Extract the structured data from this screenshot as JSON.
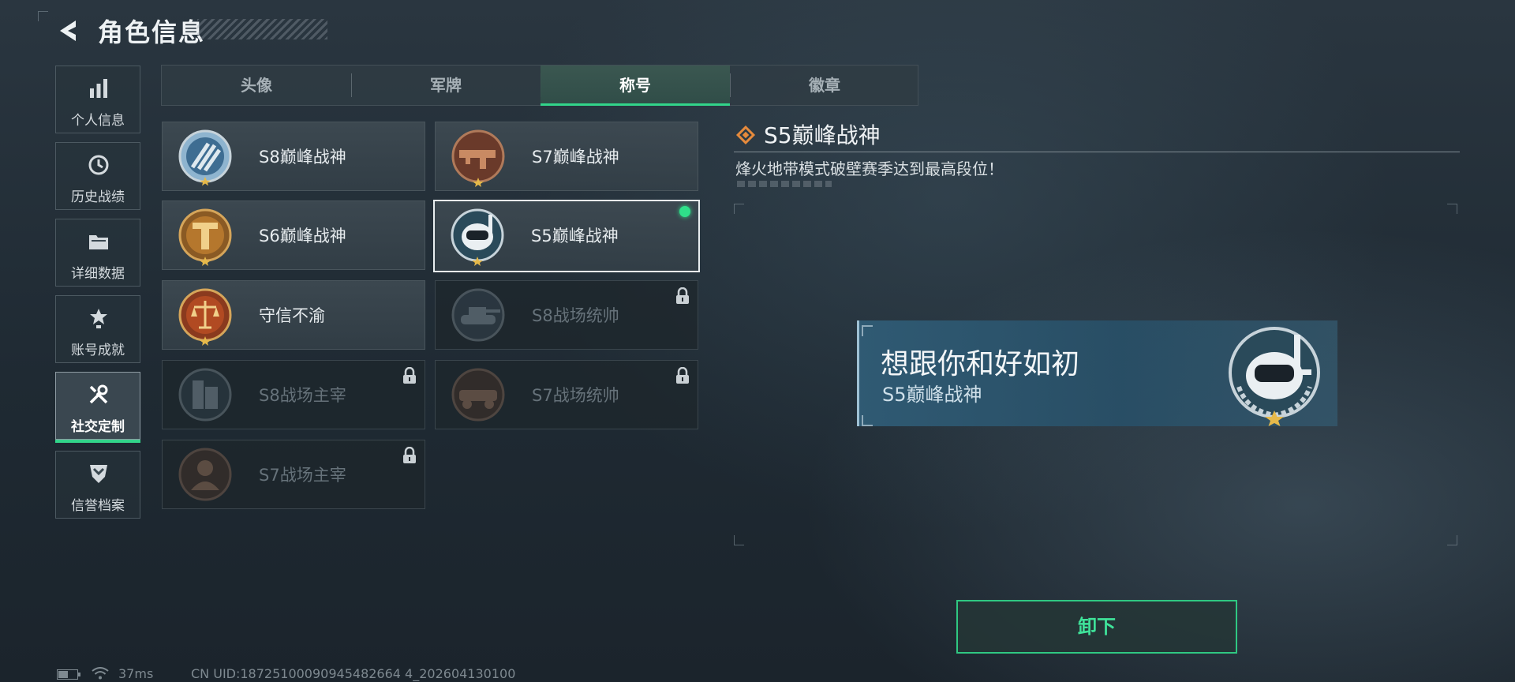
{
  "header": {
    "title": "角色信息",
    "back_icon": "chevron-left-icon"
  },
  "sidebar": {
    "items": [
      {
        "label": "个人信息",
        "icon": "bar-chart-icon",
        "active": false
      },
      {
        "label": "历史战绩",
        "icon": "history-clock-icon",
        "active": false
      },
      {
        "label": "详细数据",
        "icon": "folder-icon",
        "active": false
      },
      {
        "label": "账号成就",
        "icon": "achievement-badge-icon",
        "active": false
      },
      {
        "label": "社交定制",
        "icon": "tools-wrench-icon",
        "active": true
      },
      {
        "label": "信誉档案",
        "icon": "shield-chevron-icon",
        "active": false
      }
    ]
  },
  "tabs": [
    {
      "label": "头像",
      "active": false
    },
    {
      "label": "军牌",
      "active": false
    },
    {
      "label": "称号",
      "active": true
    },
    {
      "label": "徽章",
      "active": false
    }
  ],
  "titles": [
    {
      "name": "S8巅峰战神",
      "emblem": "blue-stripes-emblem-icon",
      "locked": false,
      "selected": false
    },
    {
      "name": "S7巅峰战神",
      "emblem": "bronze-gun-emblem-icon",
      "locked": false,
      "selected": false
    },
    {
      "name": "S6巅峰战神",
      "emblem": "gold-t-emblem-icon",
      "locked": false,
      "selected": false
    },
    {
      "name": "S5巅峰战神",
      "emblem": "diver-skull-emblem-icon",
      "locked": false,
      "selected": true
    },
    {
      "name": "守信不渝",
      "emblem": "scales-emblem-icon",
      "locked": false,
      "selected": false
    },
    {
      "name": "S8战场统帅",
      "emblem": "tank-emblem-icon",
      "locked": true,
      "selected": false
    },
    {
      "name": "S8战场主宰",
      "emblem": "building-emblem-icon",
      "locked": true,
      "selected": false
    },
    {
      "name": "S7战场统帅",
      "emblem": "vehicle-emblem-icon",
      "locked": true,
      "selected": false
    },
    {
      "name": "S7战场主宰",
      "emblem": "soldier-emblem-icon",
      "locked": true,
      "selected": false
    }
  ],
  "detail": {
    "title": "S5巅峰战神",
    "description": "烽火地带模式破壁赛季达到最高段位！",
    "icon": "orange-diamond-icon"
  },
  "nameplate": {
    "player_name": "想跟你和好如初",
    "title": "S5巅峰战神",
    "emblem": "diver-skull-emblem-icon"
  },
  "actions": {
    "unequip_label": "卸下"
  },
  "status": {
    "ping": "37ms",
    "uid": "CN UID:18725100090945482664 4_202604130100",
    "battery_icon": "battery-icon",
    "wifi_icon": "wifi-icon"
  },
  "colors": {
    "accent": "#32d48a",
    "detail_icon": "#e58a3c",
    "plate": "#305c76"
  }
}
